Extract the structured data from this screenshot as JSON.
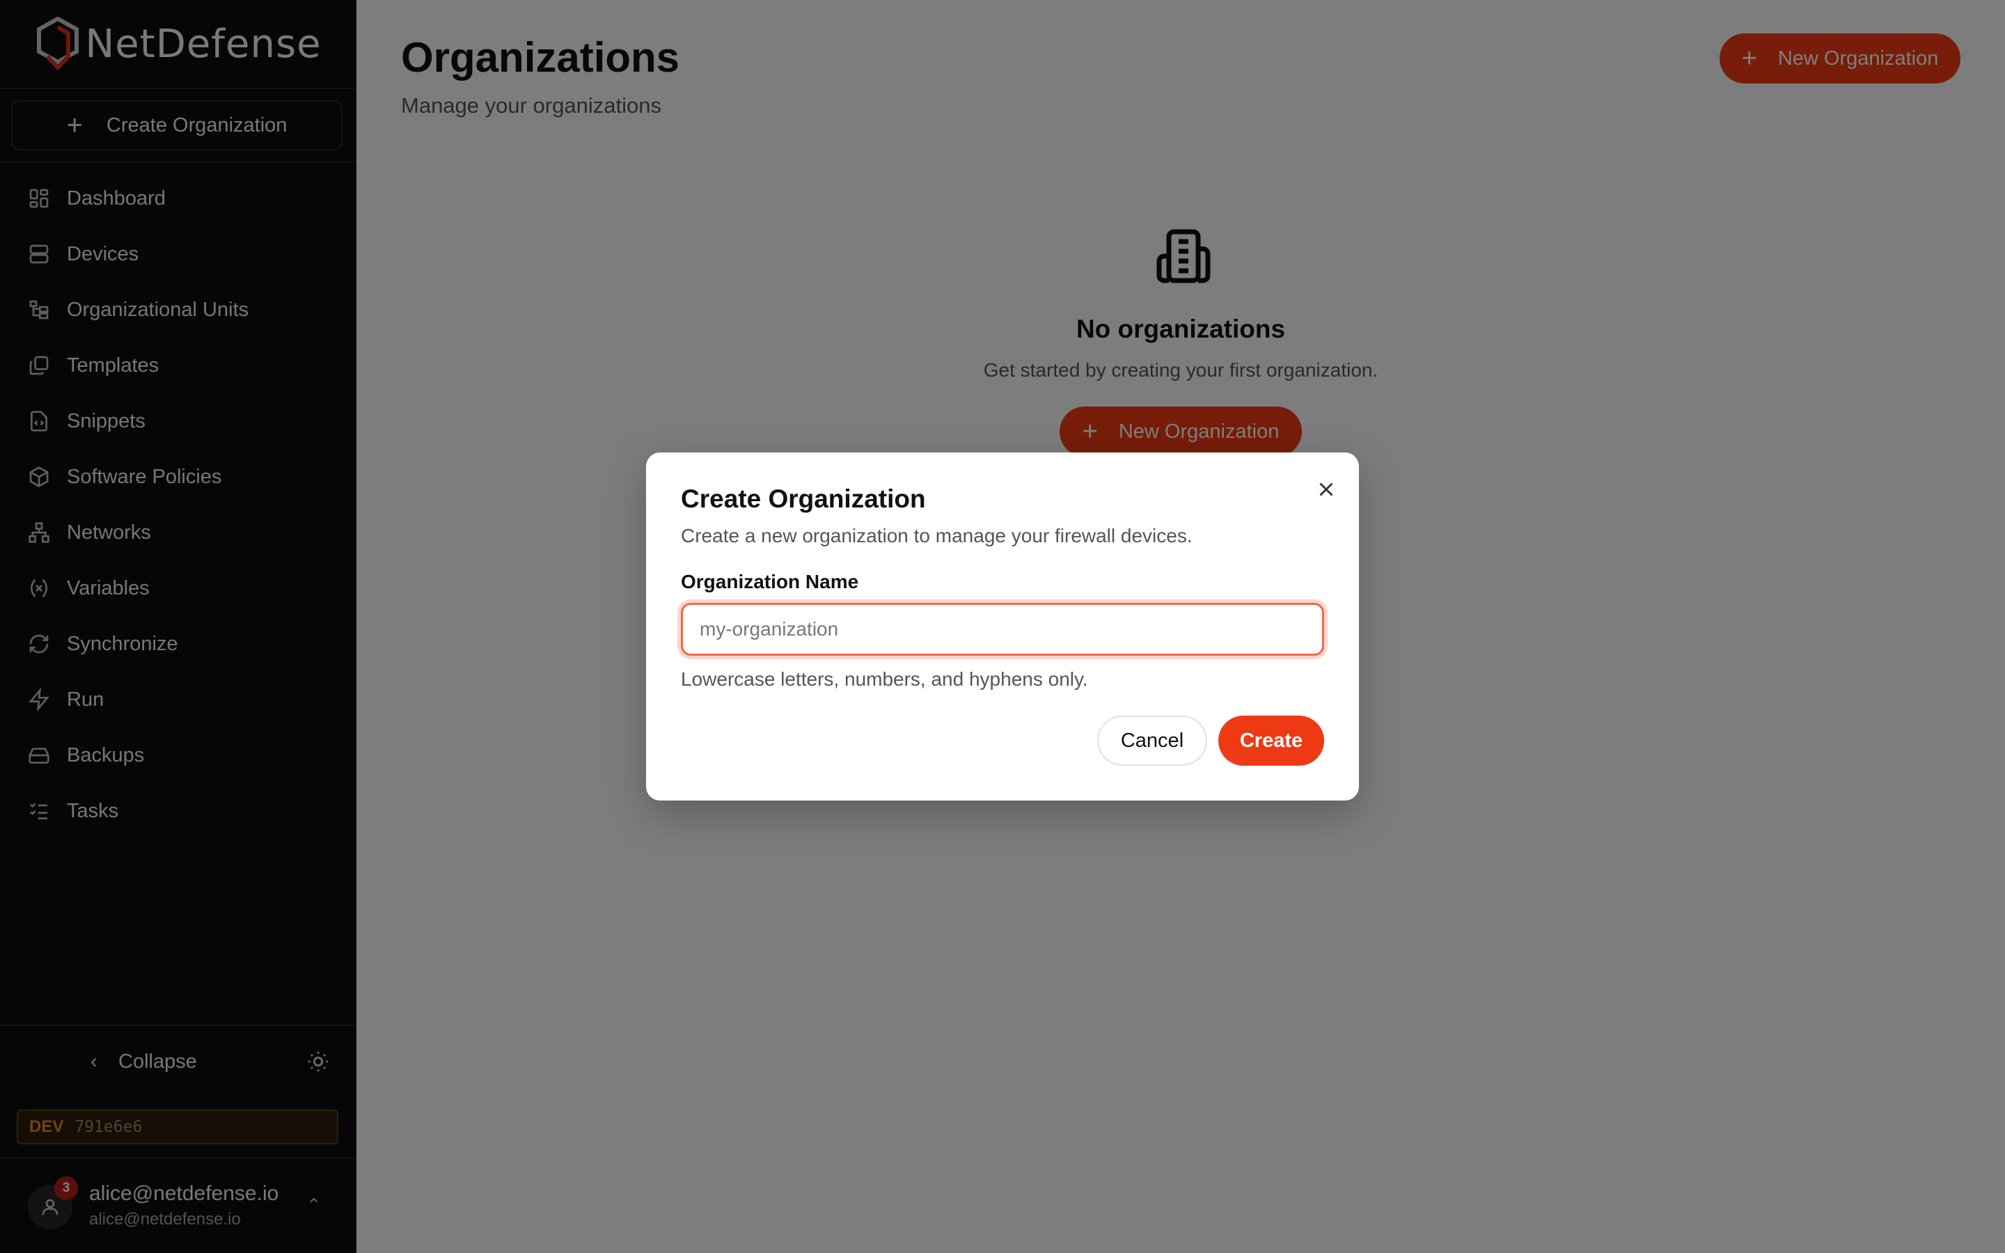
{
  "app": {
    "name": "NetDefense",
    "brand_color": "#ee3a14"
  },
  "sidebar": {
    "create_label": "Create Organization",
    "items": [
      {
        "label": "Dashboard",
        "icon": "dashboard-icon"
      },
      {
        "label": "Devices",
        "icon": "server-icon"
      },
      {
        "label": "Organizational Units",
        "icon": "tree-icon"
      },
      {
        "label": "Templates",
        "icon": "copy-icon"
      },
      {
        "label": "Snippets",
        "icon": "file-code-icon"
      },
      {
        "label": "Software Policies",
        "icon": "package-icon"
      },
      {
        "label": "Networks",
        "icon": "network-icon"
      },
      {
        "label": "Variables",
        "icon": "variable-icon"
      },
      {
        "label": "Synchronize",
        "icon": "refresh-icon"
      },
      {
        "label": "Run",
        "icon": "zap-icon"
      },
      {
        "label": "Backups",
        "icon": "hard-drive-icon"
      },
      {
        "label": "Tasks",
        "icon": "list-checks-icon"
      }
    ],
    "collapse_label": "Collapse",
    "env": {
      "tag": "DEV",
      "hash": "791e6e6"
    },
    "user": {
      "name": "alice@netdefense.io",
      "email": "alice@netdefense.io",
      "notifications": "3"
    }
  },
  "main": {
    "title": "Organizations",
    "subtitle": "Manage your organizations",
    "new_button": "New Organization",
    "empty": {
      "title": "No organizations",
      "subtitle": "Get started by creating your first organization.",
      "button": "New Organization"
    }
  },
  "dialog": {
    "title": "Create Organization",
    "description": "Create a new organization to manage your firewall devices.",
    "field_label": "Organization Name",
    "placeholder": "my-organization",
    "value": "",
    "hint": "Lowercase letters, numbers, and hyphens only.",
    "cancel": "Cancel",
    "create": "Create"
  }
}
